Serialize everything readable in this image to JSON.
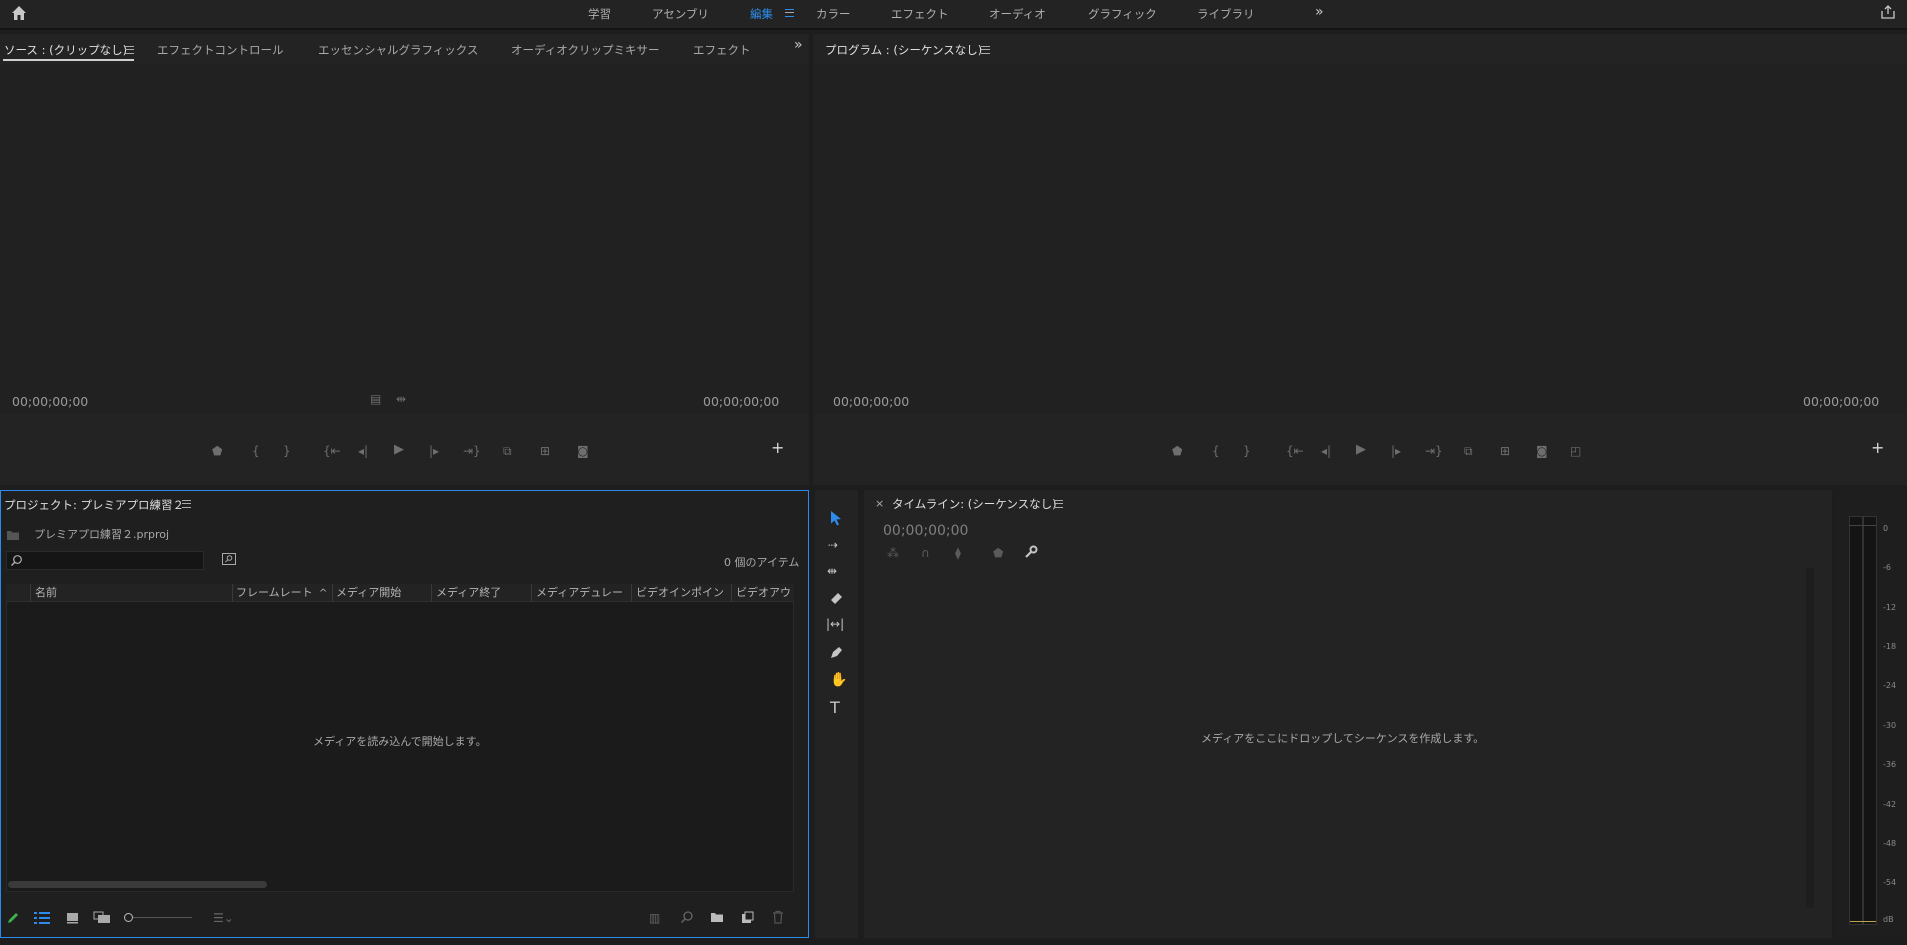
{
  "workspaces": {
    "items": [
      "学習",
      "アセンブリ",
      "編集",
      "カラー",
      "エフェクト",
      "オーディオ",
      "グラフィック",
      "ライブラリ"
    ],
    "active": "編集"
  },
  "source_panel": {
    "tabs": [
      "ソース : (クリップなし)",
      "エフェクトコントロール",
      "エッセンシャルグラフィックス",
      "オーディオクリップミキサー",
      "エフェクト"
    ],
    "timecode_left": "00;00;00;00",
    "timecode_right": "00;00;00;00"
  },
  "program_panel": {
    "title": "プログラム : (シーケンスなし)",
    "timecode_left": "00;00;00;00",
    "timecode_right": "00;00;00;00"
  },
  "project_panel": {
    "title": "プロジェクト: プレミアプロ練習２",
    "filename": "プレミアプロ練習２.prproj",
    "search_placeholder": "",
    "item_count": "0 個のアイテム",
    "columns": [
      "名前",
      "フレームレート",
      "メディア開始",
      "メディア終了",
      "メディアデュレー",
      "ビデオインポイン",
      "ビデオアウ"
    ],
    "empty_message": "メディアを読み込んで開始します。"
  },
  "timeline_panel": {
    "title": "タイムライン: (シーケンスなし)",
    "timecode": "00;00;00;00",
    "empty_message": "メディアをここにドロップしてシーケンスを作成します。"
  },
  "audio_meter": {
    "scale": [
      "0",
      "-6",
      "-12",
      "-18",
      "-24",
      "-30",
      "-36",
      "-42",
      "-48",
      "-54",
      "dB"
    ]
  },
  "colors": {
    "accent": "#2d8ceb",
    "panel_bg": "#232323",
    "frame_bg": "#1d1d1d"
  }
}
